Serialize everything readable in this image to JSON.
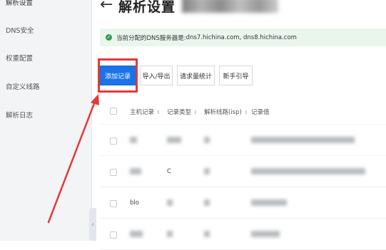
{
  "sidebar": {
    "items": [
      {
        "label": "解析设置",
        "active": true
      },
      {
        "label": "DNS安全"
      },
      {
        "label": "权重配置"
      },
      {
        "label": "自定义线路"
      },
      {
        "label": "解析日志"
      }
    ],
    "collapse_glyph": "‹"
  },
  "header": {
    "back_glyph": "←",
    "title": "解析设置"
  },
  "notice": {
    "icon": "check-circle-icon",
    "color": "#2e9e4f",
    "label": "当前分配的DNS服务器是:",
    "value": "dns7.hichina.com, dns8.hichina.com"
  },
  "toolbar": {
    "add_record": "添加记录",
    "import_export": "导入/导出",
    "query_stats": "请求量统计",
    "beginner_guide": "新手引导",
    "accent": "#1a73e8",
    "highlight_color": "#e53935"
  },
  "table": {
    "headers": [
      "主机记录",
      "记录类型",
      "解析线路(isp)",
      "记录值"
    ],
    "sort_glyph": "⇕",
    "rows": [
      {
        "host": "",
        "type": "",
        "line": "",
        "value": ""
      },
      {
        "host": "",
        "type": "C",
        "line": "",
        "value": ""
      },
      {
        "host": "blo",
        "type": "",
        "line": "",
        "value": ""
      },
      {
        "host": "",
        "type": "",
        "line": "",
        "value": ""
      }
    ]
  }
}
